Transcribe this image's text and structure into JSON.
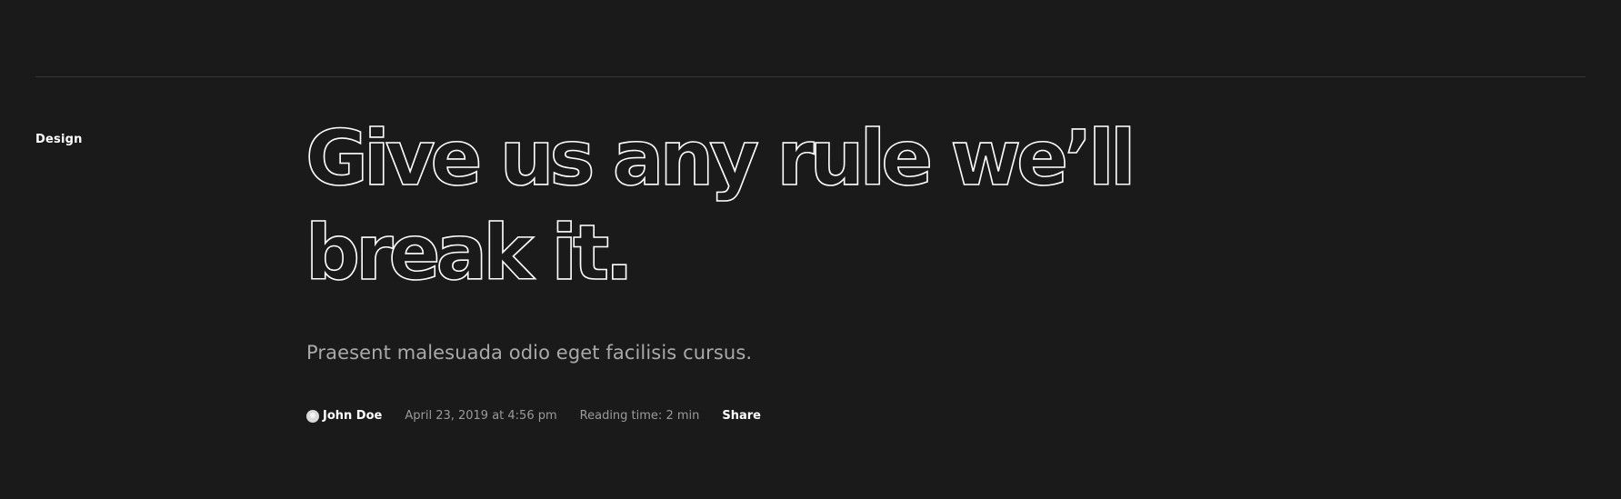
{
  "post": {
    "category": "Design",
    "headline": {
      "line1": "Give us any rule we’ll",
      "line2": "break it."
    },
    "subtitle": "Praesent malesuada odio eget facilisis cursus.",
    "meta": {
      "author": "John Doe",
      "date": "April 23, 2019 at 4:56 pm",
      "reading_time": "Reading time: 2 min",
      "share_label": "Share"
    }
  },
  "icons": {
    "avatar": "user-avatar-icon"
  },
  "colors": {
    "background": "#1a1a1a",
    "text": "#ffffff",
    "muted": "#a9a9a9",
    "divider": "#333333"
  }
}
